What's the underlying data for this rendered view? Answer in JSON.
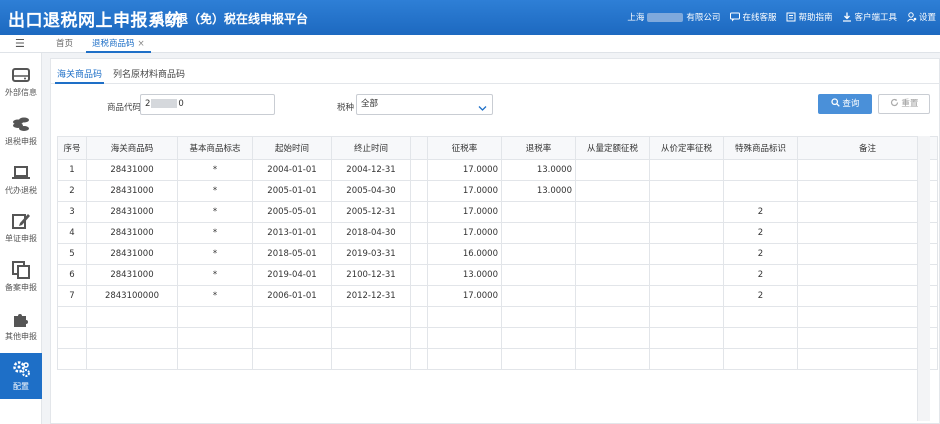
{
  "header": {
    "title": "出口退税网上申报系统",
    "subtitle": "出口退（免）税在线申报平台",
    "company_prefix": "上海",
    "company_suffix": "有限公司",
    "online_service": "在线客服",
    "help": "帮助指南",
    "client_tools": "客户端工具",
    "settings": "设置"
  },
  "tabbar": {
    "home": "首页",
    "active_tab": "退税商品码",
    "close": "×"
  },
  "sidebar": {
    "items": [
      {
        "label": "外部信息",
        "icon": "hard-drive-icon"
      },
      {
        "label": "退税申报",
        "icon": "coins-icon"
      },
      {
        "label": "代办退税",
        "icon": "laptop-icon"
      },
      {
        "label": "单证申报",
        "icon": "edit-icon"
      },
      {
        "label": "备案申报",
        "icon": "copy-icon"
      },
      {
        "label": "其他申报",
        "icon": "puzzle-icon"
      },
      {
        "label": "配置",
        "icon": "gears-icon"
      }
    ],
    "active_index": 6
  },
  "subtabs": {
    "customs_code": "海关商品码",
    "material_code": "列名原材料商品码"
  },
  "filters": {
    "code_label": "商品代码",
    "code_value_start": "2",
    "code_value_end": "0",
    "tax_label": "税种",
    "tax_value": "全部",
    "query_button": "查询",
    "reset_button": "重置"
  },
  "table": {
    "headers": [
      "序号",
      "海关商品码",
      "基本商品标志",
      "起始时间",
      "终止时间",
      "",
      "征税率",
      "退税率",
      "从量定额征税",
      "从价定率征税",
      "特殊商品标识",
      "备注"
    ],
    "rows": [
      [
        "1",
        "28431000",
        "*",
        "2004-01-01",
        "2004-12-31",
        "",
        "17.0000",
        "13.0000",
        "",
        "",
        "",
        ""
      ],
      [
        "2",
        "28431000",
        "*",
        "2005-01-01",
        "2005-04-30",
        "",
        "17.0000",
        "13.0000",
        "",
        "",
        "",
        ""
      ],
      [
        "3",
        "28431000",
        "*",
        "2005-05-01",
        "2005-12-31",
        "",
        "17.0000",
        "",
        "",
        "",
        "2",
        ""
      ],
      [
        "4",
        "28431000",
        "*",
        "2013-01-01",
        "2018-04-30",
        "",
        "17.0000",
        "",
        "",
        "",
        "2",
        ""
      ],
      [
        "5",
        "28431000",
        "*",
        "2018-05-01",
        "2019-03-31",
        "",
        "16.0000",
        "",
        "",
        "",
        "2",
        ""
      ],
      [
        "6",
        "28431000",
        "*",
        "2019-04-01",
        "2100-12-31",
        "",
        "13.0000",
        "",
        "",
        "",
        "2",
        ""
      ],
      [
        "7",
        "2843100000",
        "*",
        "2006-01-01",
        "2012-12-31",
        "",
        "17.0000",
        "",
        "",
        "",
        "2",
        ""
      ]
    ],
    "empty_rows": 3
  },
  "colors": {
    "brand": "#1e6fc7",
    "header_bg": "#2e7fd6",
    "query_button": "#4a90d9"
  }
}
